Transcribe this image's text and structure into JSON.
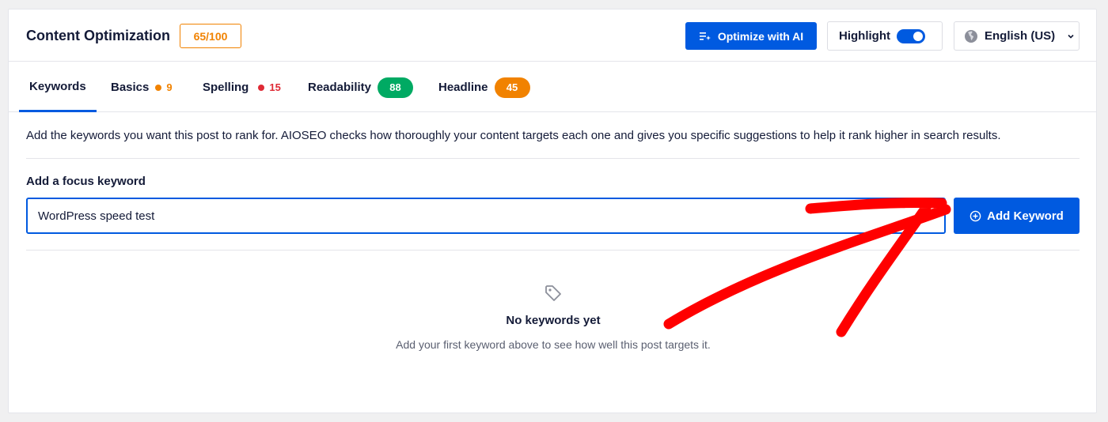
{
  "header": {
    "title": "Content Optimization",
    "score": "65/100",
    "optimize_label": "Optimize with AI",
    "highlight_label": "Highlight",
    "highlight_on": true,
    "language": "English (US)"
  },
  "tabs": [
    {
      "label": "Keywords",
      "active": true
    },
    {
      "label": "Basics",
      "count": "9",
      "color": "#f18200"
    },
    {
      "label": "Spelling",
      "count": "15",
      "color": "#df2a35"
    },
    {
      "label": "Readability",
      "score": "88",
      "color": "#00aa63"
    },
    {
      "label": "Headline",
      "score": "45",
      "color": "#f18200"
    }
  ],
  "main": {
    "description": "Add the keywords you want this post to rank for. AIOSEO checks how thoroughly your content targets each one and gives you specific suggestions to help it rank higher in search results.",
    "focus_label": "Add a focus keyword",
    "keyword_value": "WordPress speed test",
    "add_button": "Add Keyword"
  },
  "empty_state": {
    "title": "No keywords yet",
    "subtitle": "Add your first keyword above to see how well this post targets it."
  },
  "colors": {
    "accent": "#005ae0",
    "warning": "#f18200",
    "error": "#df2a35",
    "success": "#00aa63",
    "annotation": "#ff0000"
  },
  "icons": {
    "optimize": "sparkle-list-icon",
    "language": "globe-icon",
    "dropdown": "chevron-down-icon",
    "add": "plus-circle-icon",
    "empty": "tag-icon"
  }
}
